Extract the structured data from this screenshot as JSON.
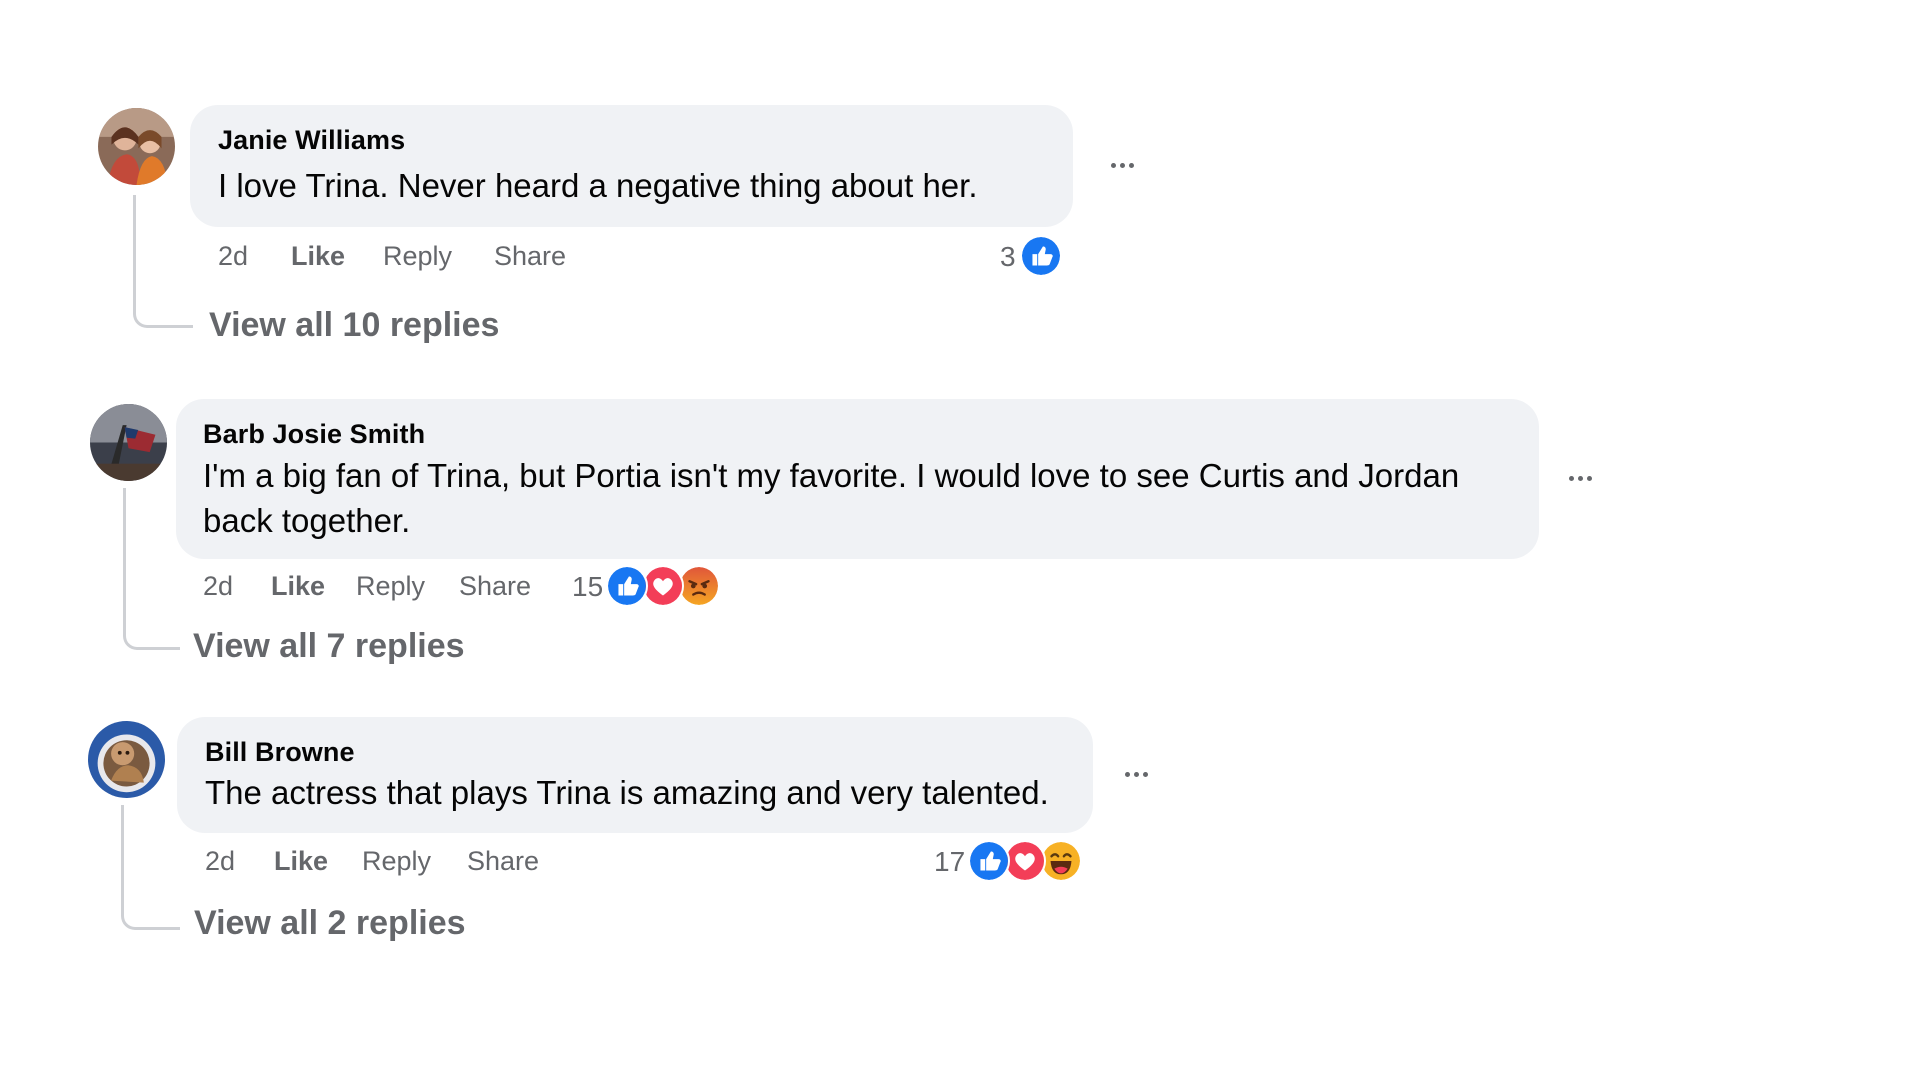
{
  "comments": [
    {
      "author": "Janie Williams",
      "text": "I love Trina. Never heard a negative thing about her.",
      "time": "2d",
      "like_label": "Like",
      "reply_label": "Reply",
      "share_label": "Share",
      "reaction_count": "3",
      "reactions": [
        "like-icon"
      ],
      "view_replies": "View all 10 replies",
      "more_icon": "more-options-icon"
    },
    {
      "author": "Barb Josie Smith",
      "text_line1": "I'm a big fan of Trina, but Portia isn't my favorite. I would love to see Curtis and Jordan",
      "text_line2": "back together.",
      "time": "2d",
      "like_label": "Like",
      "reply_label": "Reply",
      "share_label": "Share",
      "reaction_count": "15",
      "reactions": [
        "like-icon",
        "love-icon",
        "angry-icon"
      ],
      "view_replies": "View all 7 replies",
      "more_icon": "more-options-icon"
    },
    {
      "author": "Bill Browne",
      "text": "The actress that plays Trina is amazing and very talented.",
      "time": "2d",
      "like_label": "Like",
      "reply_label": "Reply",
      "share_label": "Share",
      "reaction_count": "17",
      "reactions": [
        "like-icon",
        "love-icon",
        "haha-icon"
      ],
      "view_replies": "View all 2 replies",
      "more_icon": "more-options-icon"
    }
  ],
  "colors": {
    "bubble": "#f0f2f5",
    "secondary_text": "#65676b",
    "like_blue": "#1877f2",
    "love_red": "#f33e58",
    "angry_orange": "#e9710f",
    "haha_yellow": "#f7b125"
  }
}
